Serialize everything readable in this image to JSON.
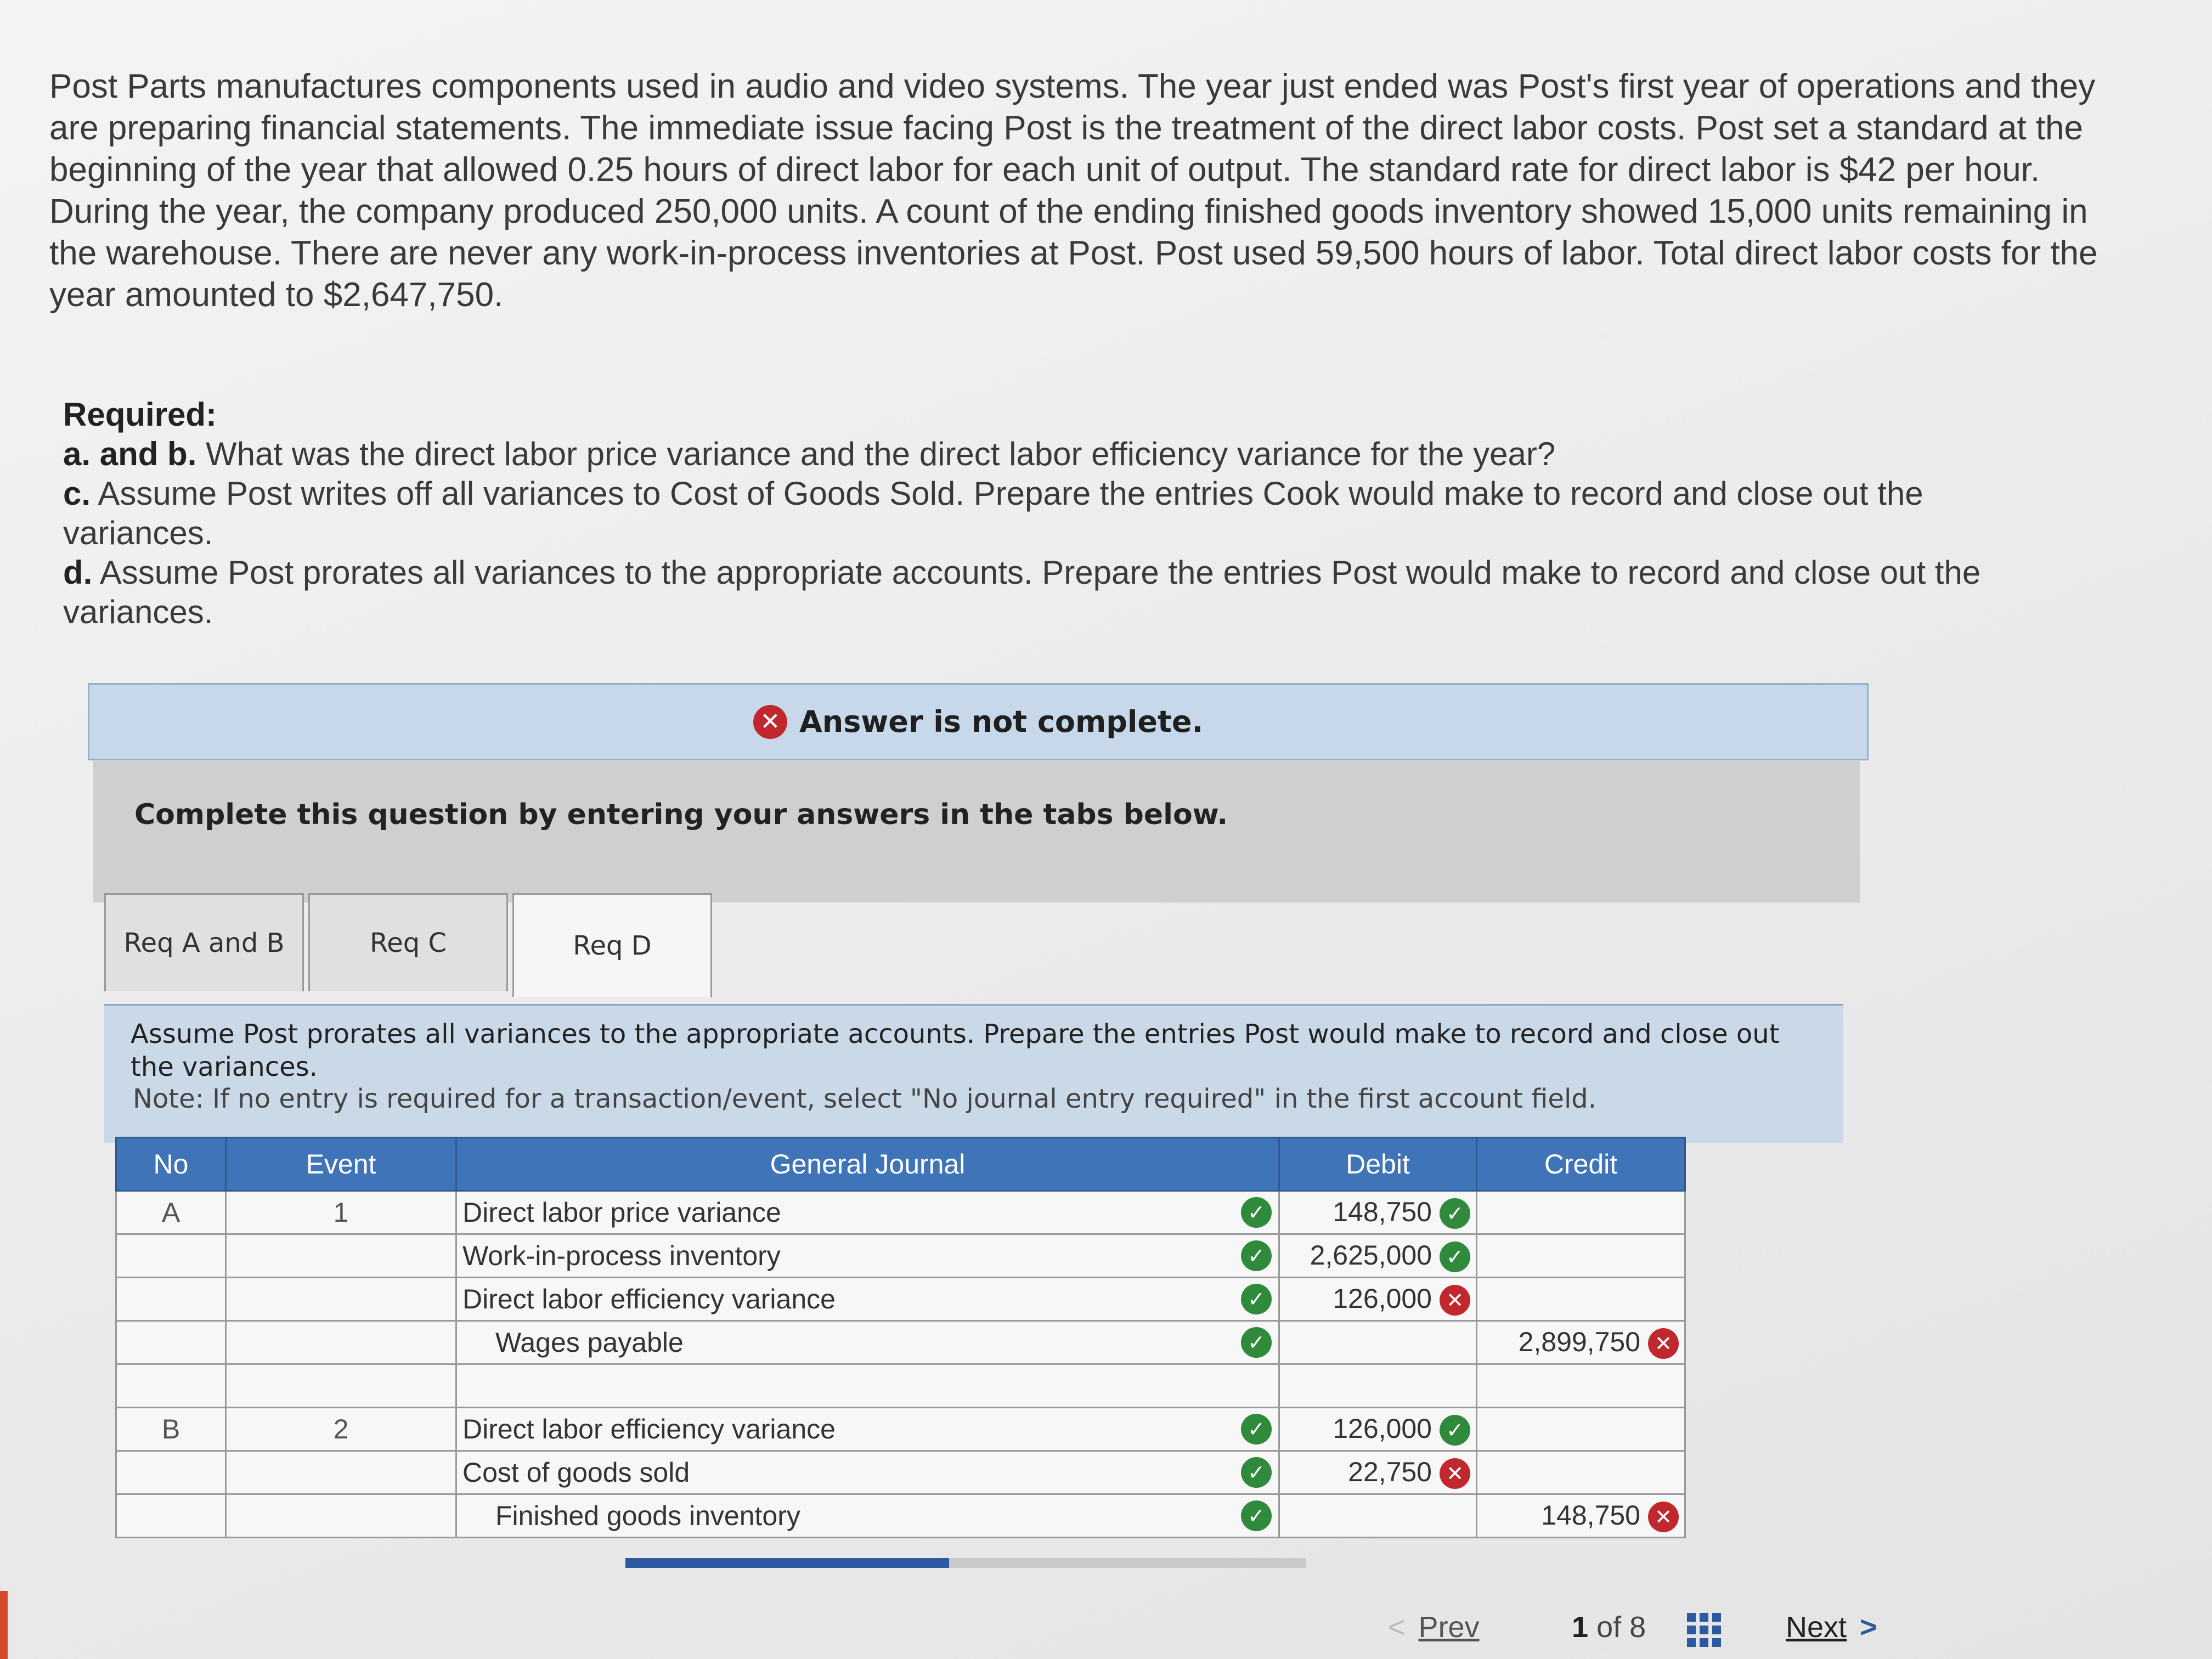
{
  "problem_text": "Post Parts manufactures components used in audio and video systems. The year just ended was Post's first year of operations and they are preparing financial statements. The immediate issue facing Post is the treatment of the direct labor costs. Post set a standard at the beginning of the year that allowed 0.25 hours of direct labor for each unit of output. The standard rate for direct labor is $42 per hour. During the year, the company produced 250,000 units. A count of the ending finished goods inventory showed 15,000 units remaining in the warehouse. There are never any work-in-process inventories at Post. Post used 59,500 hours of labor. Total direct labor costs for the year amounted to $2,647,750.",
  "required": {
    "heading": "Required:",
    "items": [
      {
        "label": "a. and b.",
        "text": " What was the direct labor price variance and the direct labor efficiency variance for the year?"
      },
      {
        "label": "c.",
        "text": " Assume Post writes off all variances to Cost of Goods Sold. Prepare the entries Cook would make to record and close out the variances."
      },
      {
        "label": "d.",
        "text": " Assume Post prorates all variances to the appropriate accounts. Prepare the entries Post would make to record and close out the variances."
      }
    ]
  },
  "banner": {
    "status_icon": "x-circle-icon",
    "text": "Answer is not complete.",
    "color": "#c0282d"
  },
  "instruction": "Complete this question by entering your answers in the tabs below.",
  "tabs": [
    {
      "label": "Req A and B",
      "active": false
    },
    {
      "label": "Req C",
      "active": false
    },
    {
      "label": "Req D",
      "active": true
    }
  ],
  "panel": {
    "text": "Assume Post prorates all variances to the appropriate accounts. Prepare the entries Post would make to record and close out the variances.",
    "note": "Note: If no entry is required for a transaction/event, select \"No journal entry required\" in the first account field."
  },
  "journal": {
    "headers": {
      "no": "No",
      "event": "Event",
      "account": "General Journal",
      "debit": "Debit",
      "credit": "Credit"
    },
    "rows": [
      {
        "no": "A",
        "event": "1",
        "account": "Direct labor price variance",
        "account_ok": true,
        "debit": "148,750",
        "debit_status": "ok",
        "credit": "",
        "credit_status": "",
        "indent": false
      },
      {
        "no": "",
        "event": "",
        "account": "Work-in-process inventory",
        "account_ok": true,
        "debit": "2,625,000",
        "debit_status": "ok",
        "credit": "",
        "credit_status": "",
        "indent": false
      },
      {
        "no": "",
        "event": "",
        "account": "Direct labor efficiency variance",
        "account_ok": true,
        "debit": "126,000",
        "debit_status": "bad",
        "credit": "",
        "credit_status": "",
        "indent": false
      },
      {
        "no": "",
        "event": "",
        "account": "Wages payable",
        "account_ok": true,
        "debit": "",
        "debit_status": "",
        "credit": "2,899,750",
        "credit_status": "bad",
        "indent": true
      },
      {
        "no": "",
        "event": "",
        "account": "",
        "account_ok": false,
        "debit": "",
        "debit_status": "",
        "credit": "",
        "credit_status": "",
        "indent": false
      },
      {
        "no": "B",
        "event": "2",
        "account": "Direct labor efficiency variance",
        "account_ok": true,
        "debit": "126,000",
        "debit_status": "ok",
        "credit": "",
        "credit_status": "",
        "indent": false
      },
      {
        "no": "",
        "event": "",
        "account": "Cost of goods sold",
        "account_ok": true,
        "debit": "22,750",
        "debit_status": "bad",
        "credit": "",
        "credit_status": "",
        "indent": false
      },
      {
        "no": "",
        "event": "",
        "account": "Finished goods inventory",
        "account_ok": true,
        "debit": "",
        "debit_status": "",
        "credit": "148,750",
        "credit_status": "bad",
        "indent": true
      }
    ]
  },
  "footer": {
    "prev_label": "Prev",
    "page_current": "1",
    "page_of": "of 8",
    "next_label": "Next",
    "grid_icon": "grid-icon"
  }
}
